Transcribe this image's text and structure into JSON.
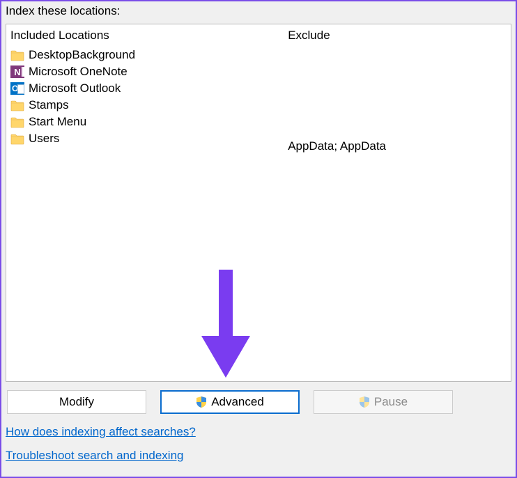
{
  "header": {
    "title": "Index these locations:"
  },
  "columns": {
    "included_header": "Included Locations",
    "exclude_header": "Exclude"
  },
  "locations": [
    {
      "icon": "folder",
      "name": "DesktopBackground",
      "exclude": ""
    },
    {
      "icon": "onenote",
      "name": "Microsoft OneNote",
      "exclude": ""
    },
    {
      "icon": "outlook",
      "name": "Microsoft Outlook",
      "exclude": ""
    },
    {
      "icon": "folder",
      "name": "Stamps",
      "exclude": ""
    },
    {
      "icon": "folder",
      "name": "Start Menu",
      "exclude": ""
    },
    {
      "icon": "folder",
      "name": "Users",
      "exclude": "AppData; AppData"
    }
  ],
  "buttons": {
    "modify": "Modify",
    "advanced": "Advanced",
    "pause": "Pause"
  },
  "links": {
    "how_indexing": "How does indexing affect searches?",
    "troubleshoot": "Troubleshoot search and indexing"
  },
  "onenote_glyph": "N",
  "outlook_glyph": "O"
}
